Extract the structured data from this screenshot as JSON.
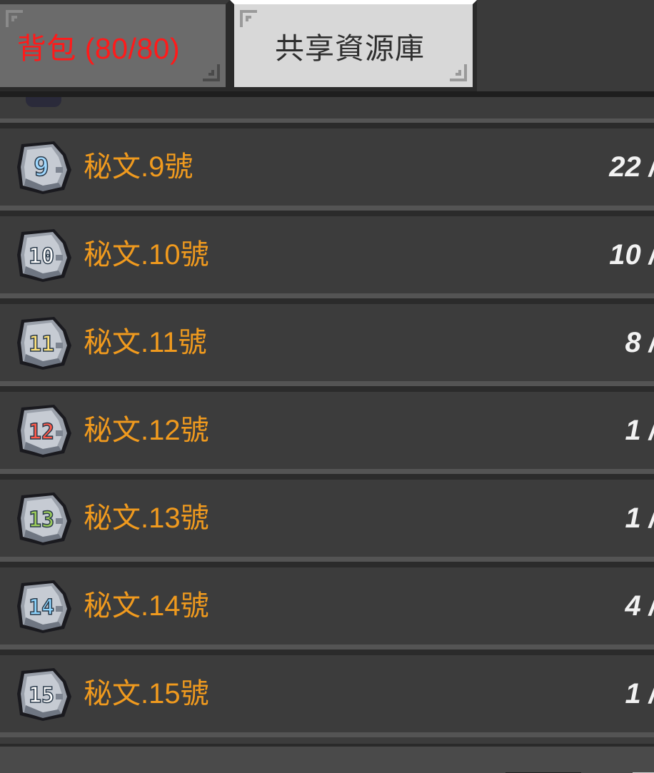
{
  "tabs": {
    "backpack_label": "背包 (80/80)",
    "shared_label": "共享資源庫"
  },
  "colors": {
    "backpack_tab_text": "#ff1a1a",
    "item_name": "#f09a1e",
    "item_count": "#f2f2f2",
    "row_bg": "#3c3c3c"
  },
  "items": [
    {
      "name": "秘文.9號",
      "count": "22 /",
      "icon": "rune-stone-9-icon",
      "numeral": "9",
      "numeral_color": "#9fd8ff"
    },
    {
      "name": "秘文.10號",
      "count": "10 /",
      "icon": "rune-stone-10-icon",
      "numeral": "10",
      "numeral_color": "#ffffff"
    },
    {
      "name": "秘文.11號",
      "count": "8 /",
      "icon": "rune-stone-11-icon",
      "numeral": "11",
      "numeral_color": "#ffe27a"
    },
    {
      "name": "秘文.12號",
      "count": "1 /",
      "icon": "rune-stone-12-icon",
      "numeral": "12",
      "numeral_color": "#ff5a4a"
    },
    {
      "name": "秘文.13號",
      "count": "1 /",
      "icon": "rune-stone-13-icon",
      "numeral": "13",
      "numeral_color": "#9ccc5a"
    },
    {
      "name": "秘文.14號",
      "count": "4 /",
      "icon": "rune-stone-14-icon",
      "numeral": "14",
      "numeral_color": "#8fd6ff"
    },
    {
      "name": "秘文.15號",
      "count": "1 /",
      "icon": "rune-stone-15-icon",
      "numeral": "15",
      "numeral_color": "#ffffff"
    }
  ]
}
